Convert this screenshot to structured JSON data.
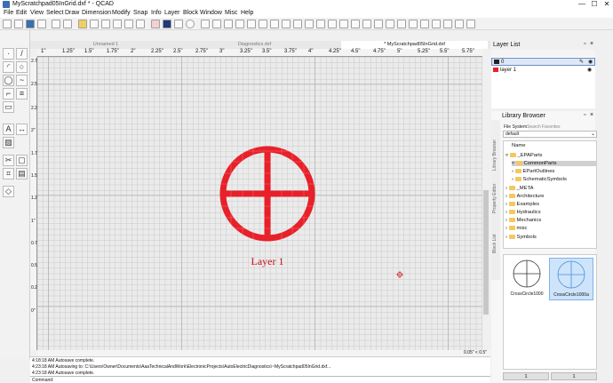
{
  "window": {
    "title": "MyScratchpad05InGrid.dxf * - QCAD",
    "controls": [
      "—",
      "☐",
      "✕"
    ]
  },
  "menu": [
    "File",
    "Edit",
    "View",
    "Select",
    "Draw",
    "Dimension",
    "Modify",
    "Snap",
    "Info",
    "Layer",
    "Block",
    "Window",
    "Misc",
    "Help"
  ],
  "tabs": [
    {
      "label": "Unnamed 1"
    },
    {
      "label": "Diagnostics.dxf"
    },
    {
      "label": "* MyScratchpad05InGrid.dxf"
    }
  ],
  "ruler": {
    "h_ticks": [
      "1\"",
      "1.25\"",
      "1.5\"",
      "1.75\"",
      "2\"",
      "2.25\"",
      "2.5\"",
      "2.75\"",
      "3\"",
      "3.25\"",
      "3.5\"",
      "3.75\"",
      "4\"",
      "4.25\"",
      "4.5\"",
      "4.75\"",
      "5\"",
      "5.25\"",
      "5.5\"",
      "5.75\""
    ],
    "v_ticks": [
      "2.75\"",
      "2.5\"",
      "2.25\"",
      "2\"",
      "1.75\"",
      "1.5\"",
      "1.25\"",
      "1\"",
      "0.75\"",
      "0.5\"",
      "0.25\"",
      "0\""
    ]
  },
  "drawing": {
    "label": "Layer 1",
    "accent_color": "#e8202a"
  },
  "status": {
    "grid_spacing": "0.05\" < 0.5\""
  },
  "log": [
    "4:18:18 AM  Autosave complete.",
    "4:23:18 AM  Autosaving to: C:\\Users\\Owner\\Documents\\AaaTechnicalAndWork\\ElectronicProjects\\AutoElectricDiagnostics\\~MyScratchpad05InGrid.dxf...",
    "4:23:18 AM  Autosave complete."
  ],
  "command": {
    "label": "Command:"
  },
  "layer_list": {
    "title": "Layer List",
    "layers": [
      {
        "name": "0"
      },
      {
        "name": "layer 1"
      }
    ]
  },
  "library": {
    "title": "Library Browser",
    "tabs": [
      "File System",
      "Search",
      "Favorites"
    ],
    "source": "default",
    "column": "Name",
    "side_tabs": [
      "Library Browser",
      "Property Editor",
      "Block List"
    ],
    "tree": [
      {
        "label": "_EPAParts",
        "depth": 0,
        "open": true
      },
      {
        "label": "CommonParts",
        "depth": 1,
        "open": true,
        "selected": true
      },
      {
        "label": "EPartOutlines",
        "depth": 1
      },
      {
        "label": "SchematicSymbols",
        "depth": 1
      },
      {
        "label": "_META",
        "depth": 0
      },
      {
        "label": "Architecture",
        "depth": 0
      },
      {
        "label": "Examples",
        "depth": 0
      },
      {
        "label": "Hydraulics",
        "depth": 0
      },
      {
        "label": "Mechanics",
        "depth": 0
      },
      {
        "label": "misc",
        "depth": 0
      },
      {
        "label": "Symbols",
        "depth": 0
      }
    ],
    "items": [
      {
        "label": "CrossCircle1000"
      },
      {
        "label": "CrossCircle1000a"
      }
    ],
    "pages": [
      "1",
      "1"
    ]
  }
}
